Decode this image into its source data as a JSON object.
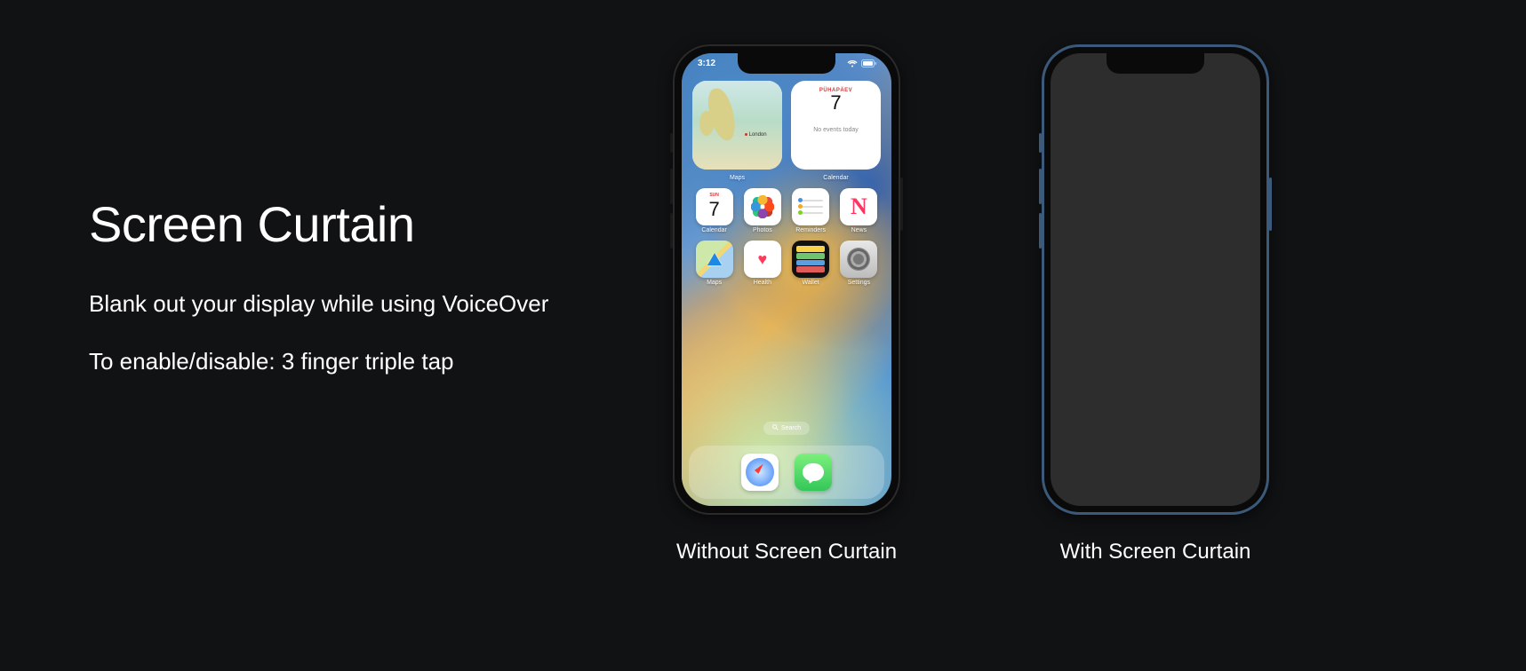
{
  "title": "Screen Curtain",
  "description": "Blank out your display while using VoiceOver",
  "instruction": "To enable/disable: 3 finger triple tap",
  "captions": {
    "without": "Without Screen Curtain",
    "with": "With Screen Curtain"
  },
  "status": {
    "time": "3:12"
  },
  "widgets": {
    "maps": {
      "label": "Maps",
      "pin": "London"
    },
    "calendar": {
      "label": "Calendar",
      "day_name": "PÜHAPÄEV",
      "day_number": "7",
      "events_text": "No events today"
    }
  },
  "apps_row1": [
    {
      "key": "calendar",
      "label": "Calendar",
      "day_top": "SUN",
      "day_num": "7"
    },
    {
      "key": "photos",
      "label": "Photos"
    },
    {
      "key": "reminders",
      "label": "Reminders"
    },
    {
      "key": "news",
      "label": "News"
    }
  ],
  "apps_row2": [
    {
      "key": "maps",
      "label": "Maps"
    },
    {
      "key": "health",
      "label": "Health"
    },
    {
      "key": "wallet",
      "label": "Wallet"
    },
    {
      "key": "settings",
      "label": "Settings"
    }
  ],
  "search_label": "Search",
  "dock": [
    {
      "key": "safari",
      "label": "Safari"
    },
    {
      "key": "messages",
      "label": "Messages"
    }
  ]
}
